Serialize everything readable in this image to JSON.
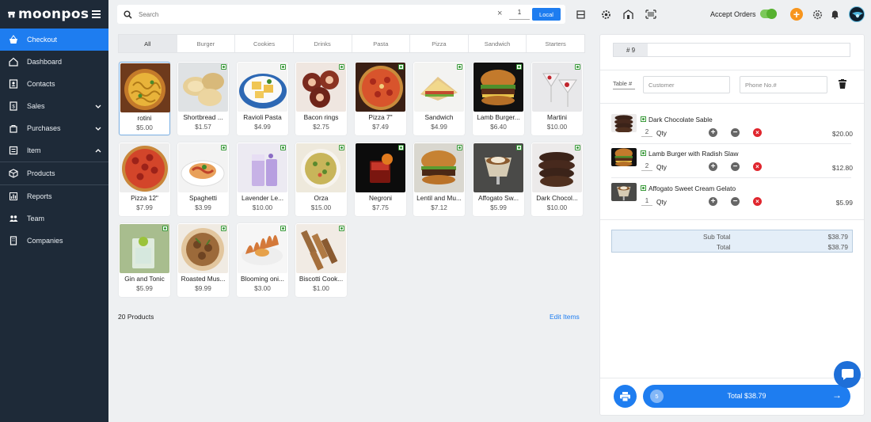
{
  "brand": {
    "name": "moonpos"
  },
  "sidebar": {
    "items": [
      {
        "label": "Checkout",
        "icon": "basket-icon",
        "active": true
      },
      {
        "label": "Dashboard",
        "icon": "home-icon"
      },
      {
        "label": "Contacts",
        "icon": "contacts-icon"
      },
      {
        "label": "Sales",
        "icon": "receipt-icon",
        "chevron": "down"
      },
      {
        "label": "Purchases",
        "icon": "bag-icon",
        "chevron": "down"
      },
      {
        "label": "Item",
        "icon": "list-icon",
        "chevron": "up"
      },
      {
        "label": "Products",
        "icon": "box-icon"
      },
      {
        "label": "Reports",
        "icon": "chart-icon"
      },
      {
        "label": "Team",
        "icon": "team-icon"
      },
      {
        "label": "Companies",
        "icon": "building-icon"
      }
    ]
  },
  "topbar": {
    "search_placeholder": "Search",
    "clear": "×",
    "qty": "1",
    "local_label": "Local",
    "accept_orders_label": "Accept Orders",
    "accept_orders_on": true,
    "plus": "+"
  },
  "categories": [
    "All",
    "Burger",
    "Cookies",
    "Drinks",
    "Pasta",
    "Pizza",
    "Sandwich",
    "Starters"
  ],
  "active_category": "All",
  "products": [
    {
      "name": "rotini",
      "price": "$5.00",
      "veg": false,
      "selected": true,
      "art": "pasta-yellow"
    },
    {
      "name": "Shortbread ...",
      "price": "$1.57",
      "veg": true,
      "art": "cookies"
    },
    {
      "name": "Ravioli Pasta",
      "price": "$4.99",
      "veg": true,
      "art": "ravioli"
    },
    {
      "name": "Bacon rings",
      "price": "$2.75",
      "veg": true,
      "art": "bacon"
    },
    {
      "name": "Pizza 7\"",
      "price": "$7.49",
      "veg": true,
      "art": "pizza"
    },
    {
      "name": "Sandwich",
      "price": "$4.99",
      "veg": true,
      "art": "sandwich"
    },
    {
      "name": "Lamb Burger...",
      "price": "$6.40",
      "veg": true,
      "art": "burger"
    },
    {
      "name": "Martini",
      "price": "$10.00",
      "veg": true,
      "art": "martini"
    },
    {
      "name": "Pizza 12\"",
      "price": "$7.99",
      "veg": false,
      "art": "pizza2"
    },
    {
      "name": "Spaghetti",
      "price": "$3.99",
      "veg": true,
      "art": "spaghetti"
    },
    {
      "name": "Lavender Le...",
      "price": "$10.00",
      "veg": true,
      "art": "lavender"
    },
    {
      "name": "Orza",
      "price": "$15.00",
      "veg": true,
      "art": "orza"
    },
    {
      "name": "Negroni",
      "price": "$7.75",
      "veg": true,
      "art": "negroni"
    },
    {
      "name": "Lentil and Mu...",
      "price": "$7.12",
      "veg": true,
      "art": "burger2"
    },
    {
      "name": "Affogato Sw...",
      "price": "$5.99",
      "veg": true,
      "art": "affogato"
    },
    {
      "name": "Dark Chocol...",
      "price": "$10.00",
      "veg": true,
      "art": "chococookie"
    },
    {
      "name": "Gin and Tonic",
      "price": "$5.99",
      "veg": true,
      "art": "gin"
    },
    {
      "name": "Roasted Mus...",
      "price": "$9.99",
      "veg": true,
      "art": "mushroom"
    },
    {
      "name": "Blooming oni...",
      "price": "$3.00",
      "veg": true,
      "art": "onion"
    },
    {
      "name": "Biscotti Cook...",
      "price": "$1.00",
      "veg": true,
      "art": "biscotti"
    }
  ],
  "product_count": "20 Products",
  "edit_items": "Edit Items",
  "order": {
    "number": "# 9",
    "table_label": "Table #",
    "customer_placeholder": "Customer",
    "phone_placeholder": "Phone No.#",
    "qty_label": "Qty",
    "lines": [
      {
        "name": "Dark Chocolate Sable",
        "qty": "2",
        "amount": "$20.00",
        "art": "chococookie"
      },
      {
        "name": "Lamb Burger with Radish Slaw",
        "qty": "2",
        "amount": "$12.80",
        "art": "burger"
      },
      {
        "name": "Affogato Sweet Cream Gelato",
        "qty": "1",
        "amount": "$5.99",
        "art": "affogato"
      }
    ],
    "subtotal_label": "Sub Total",
    "subtotal": "$38.79",
    "total_label": "Total",
    "total": "$38.79",
    "item_count": "5",
    "total_button": "Total $38.79",
    "arrow": "→"
  },
  "colors": {
    "accent": "#1e7df0",
    "sidebar": "#1e2a38",
    "veg": "#3a9a3a",
    "toggle": "#56b12f",
    "orange": "#f7951d",
    "remove": "#e0262e"
  }
}
